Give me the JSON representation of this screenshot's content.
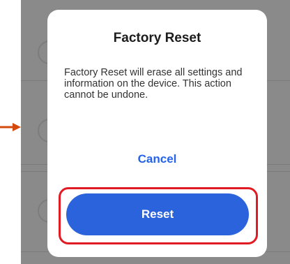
{
  "dialog": {
    "title": "Factory Reset",
    "message": "Factory Reset will erase all settings and information on the device. This action cannot be undone.",
    "cancel_label": "Cancel",
    "reset_label": "Reset"
  },
  "colors": {
    "primary": "#2b63dd",
    "cancel_text": "#2563eb",
    "highlight": "#e01b24",
    "arrow": "#d4490c",
    "scrim": "#8a8a8a"
  }
}
